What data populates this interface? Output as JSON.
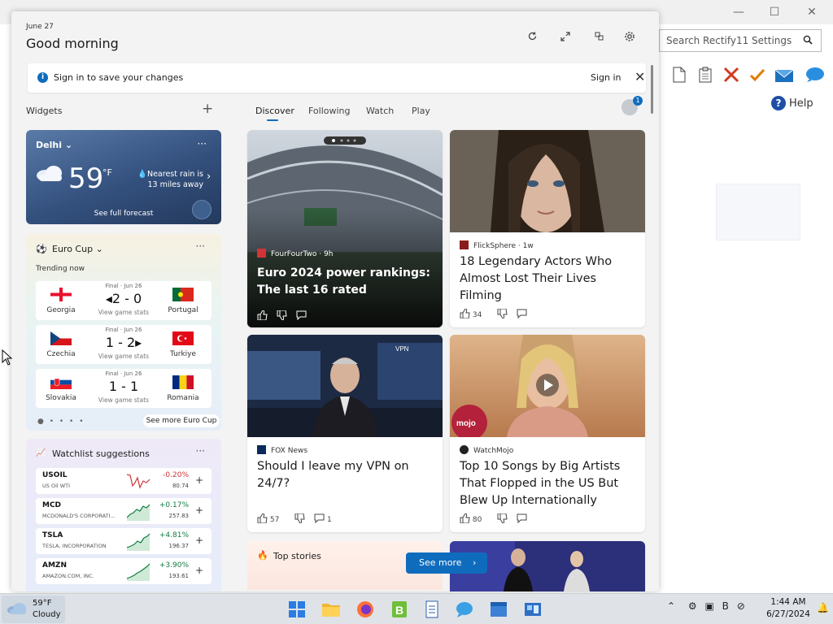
{
  "background_app": {
    "search_placeholder": "Search Rectify11 Settings",
    "help_label": "Help",
    "window_controls": {
      "minimize": "—",
      "maximize": "☐",
      "close": "✕"
    }
  },
  "panel": {
    "date": "June 27",
    "greeting": "Good morning",
    "header_icons": [
      "refresh-icon",
      "expand-icon",
      "pin-icon",
      "gear-icon"
    ]
  },
  "signin_bar": {
    "message": "Sign in to save your changes",
    "link": "Sign in",
    "close": "✕"
  },
  "widgets": {
    "title": "Widgets",
    "add": "+"
  },
  "weather": {
    "city": "Delhi",
    "chevron": "⌄",
    "temp": "59",
    "unit": "°F",
    "rain_note": "Nearest rain is 13 miles away",
    "forecast_link": "See full forecast",
    "menu": "···"
  },
  "eurocup": {
    "title": "Euro Cup",
    "chevron": "⌄",
    "menu": "···",
    "trending": "Trending now",
    "matches": [
      {
        "home": "Georgia",
        "away": "Portugal",
        "status": "Final · Jun 26",
        "score": "◂2 - 0",
        "stats": "View game stats"
      },
      {
        "home": "Czechia",
        "away": "Turkiye",
        "status": "Final · Jun 26",
        "score": "1 - 2▸",
        "stats": "View game stats"
      },
      {
        "home": "Slovakia",
        "away": "Romania",
        "status": "Final · Jun 26",
        "score": "1 - 1",
        "stats": "View game stats"
      }
    ],
    "pager": "● • • • •",
    "see_more": "See more Euro Cup"
  },
  "watchlist": {
    "title": "Watchlist suggestions",
    "menu": "···",
    "stocks": [
      {
        "symbol": "USOIL",
        "name": "US Oil WTI",
        "change": "-0.20%",
        "price": "80.74",
        "color": "#d13438"
      },
      {
        "symbol": "MCD",
        "name": "MCDONALD'S CORPORATI...",
        "change": "+0.17%",
        "price": "257.83",
        "color": "#107c41"
      },
      {
        "symbol": "TSLA",
        "name": "TESLA, INCORPORATION",
        "change": "+4.81%",
        "price": "196.37",
        "color": "#107c41"
      },
      {
        "symbol": "AMZN",
        "name": "AMAZON.COM, INC.",
        "change": "+3.90%",
        "price": "193.61",
        "color": "#107c41"
      }
    ]
  },
  "feed": {
    "tabs": [
      "Discover",
      "Following",
      "Watch",
      "Play"
    ],
    "profile_badge": "1",
    "cards": [
      {
        "source": "FourFourTwo · 9h",
        "headline": "Euro 2024 power rankings: The last 16 rated",
        "likes": "",
        "comments": ""
      },
      {
        "source": "FlickSphere · 1w",
        "headline": "18 Legendary Actors Who Almost Lost Their Lives Filming",
        "likes": "34",
        "comments": ""
      },
      {
        "source": "FOX News",
        "headline": "Should I leave my VPN on 24/7?",
        "likes": "57",
        "comments": "1",
        "overlay": "VPN"
      },
      {
        "source": "WatchMojo",
        "headline": "Top 10 Songs by Big Artists That Flopped in the US But Blew Up Internationally",
        "likes": "80",
        "comments": "",
        "overlay": "mojo"
      }
    ],
    "top_stories": "Top stories",
    "see_more": "See more"
  },
  "taskbar": {
    "weather_temp": "59°F",
    "weather_cond": "Cloudy",
    "time": "1:44 AM",
    "date": "6/27/2024",
    "tray_chevron": "⌃"
  },
  "colors": {
    "accent": "#0f6cbd",
    "negative": "#d13438",
    "positive": "#107c41"
  }
}
